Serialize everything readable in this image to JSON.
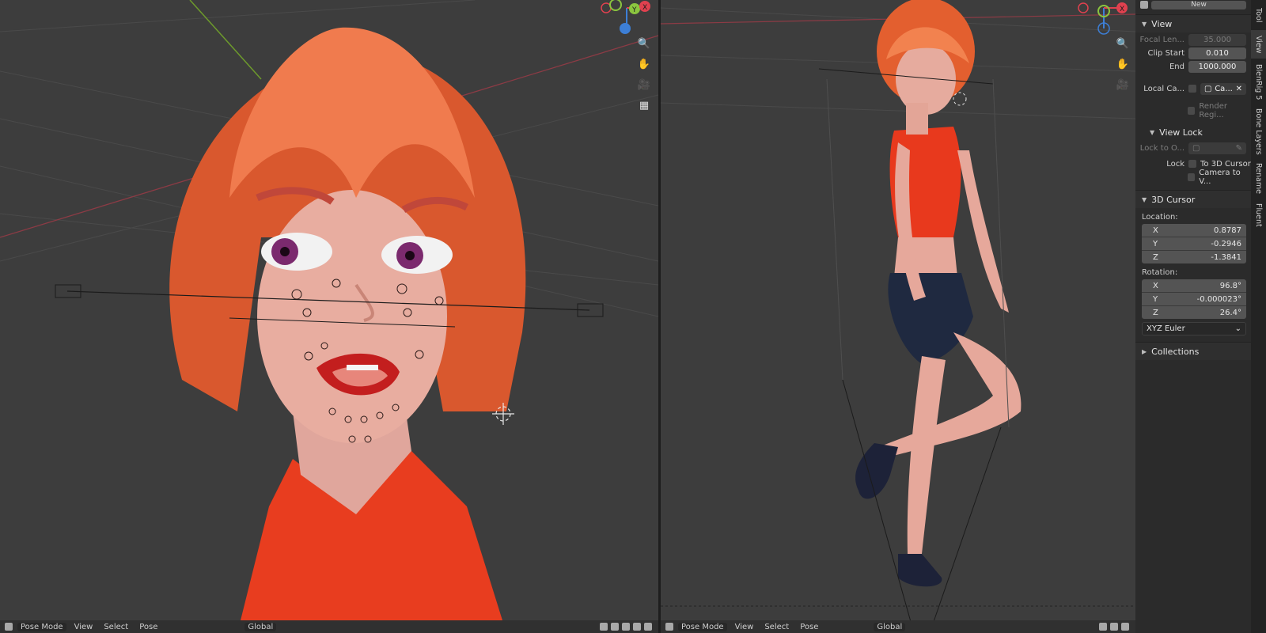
{
  "left_viewport": {
    "header": {
      "mode": "Pose Mode",
      "menus": [
        "View",
        "Select",
        "Pose"
      ],
      "transform_orientation": "Global"
    }
  },
  "right_viewport": {
    "header": {
      "mode": "Pose Mode",
      "menus": [
        "View",
        "Select",
        "Pose"
      ],
      "transform_orientation": "Global"
    }
  },
  "gizmo": {
    "axis_x_label": "X",
    "axis_y_label": "Y",
    "colors": {
      "x": "#e0414f",
      "y": "#8bc53f",
      "z": "#3d7fd6"
    }
  },
  "npanel": {
    "top_button": "New",
    "view": {
      "title": "View",
      "focal_length_label": "Focal Len...",
      "focal_length_value": "35.000",
      "clip_start_label": "Clip Start",
      "clip_start_value": "0.010",
      "clip_end_label": "End",
      "clip_end_value": "1000.000",
      "local_camera_label": "Local Ca...",
      "local_camera_value": "Ca...",
      "render_region_label": "Render Regi...",
      "view_lock": {
        "title": "View Lock",
        "lock_to_object_label": "Lock to O...",
        "lock_label": "Lock",
        "to_3d_cursor_label": "To 3D Cursor",
        "camera_to_view_label": "Camera to V..."
      }
    },
    "cursor": {
      "title": "3D Cursor",
      "location_label": "Location:",
      "location": [
        {
          "axis": "X",
          "value": "0.8787"
        },
        {
          "axis": "Y",
          "value": "-0.2946"
        },
        {
          "axis": "Z",
          "value": "-1.3841"
        }
      ],
      "rotation_label": "Rotation:",
      "rotation": [
        {
          "axis": "X",
          "value": "96.8°"
        },
        {
          "axis": "Y",
          "value": "-0.000023°"
        },
        {
          "axis": "Z",
          "value": "26.4°"
        }
      ],
      "rotation_mode": "XYZ Euler"
    },
    "collections_title": "Collections"
  },
  "tabs": [
    "Tool",
    "View",
    "BlenRig 5",
    "Bone Layers",
    "Rename",
    "Fluent"
  ],
  "active_tab": "View"
}
